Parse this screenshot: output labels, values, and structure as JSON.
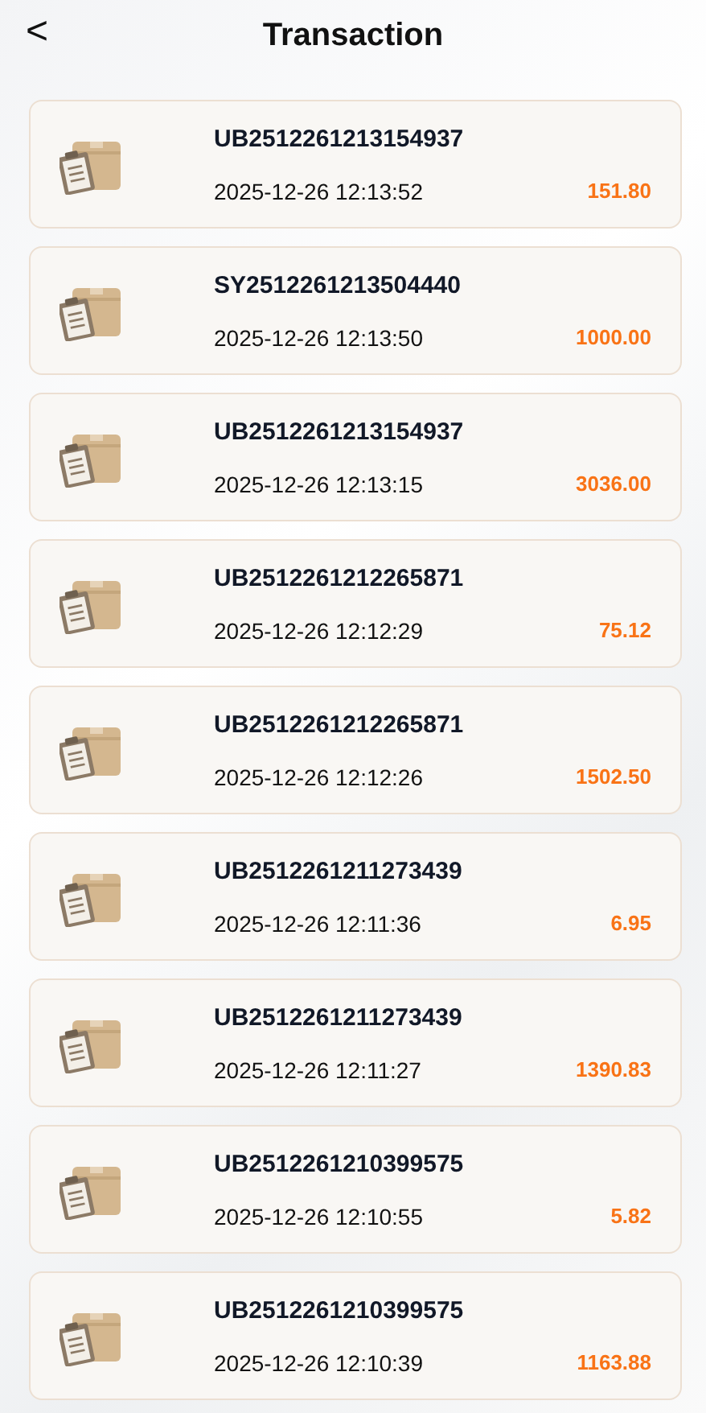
{
  "header": {
    "back": "<",
    "title": "Transaction"
  },
  "transactions": [
    {
      "id": "UB2512261213154937",
      "time": "2025-12-26 12:13:52",
      "amount": "151.80"
    },
    {
      "id": "SY2512261213504440",
      "time": "2025-12-26 12:13:50",
      "amount": "1000.00"
    },
    {
      "id": "UB2512261213154937",
      "time": "2025-12-26 12:13:15",
      "amount": "3036.00"
    },
    {
      "id": "UB2512261212265871",
      "time": "2025-12-26 12:12:29",
      "amount": "75.12"
    },
    {
      "id": "UB2512261212265871",
      "time": "2025-12-26 12:12:26",
      "amount": "1502.50"
    },
    {
      "id": "UB2512261211273439",
      "time": "2025-12-26 12:11:36",
      "amount": "6.95"
    },
    {
      "id": "UB2512261211273439",
      "time": "2025-12-26 12:11:27",
      "amount": "1390.83"
    },
    {
      "id": "UB2512261210399575",
      "time": "2025-12-26 12:10:55",
      "amount": "5.82"
    },
    {
      "id": "UB2512261210399575",
      "time": "2025-12-26 12:10:39",
      "amount": "1163.88"
    }
  ]
}
